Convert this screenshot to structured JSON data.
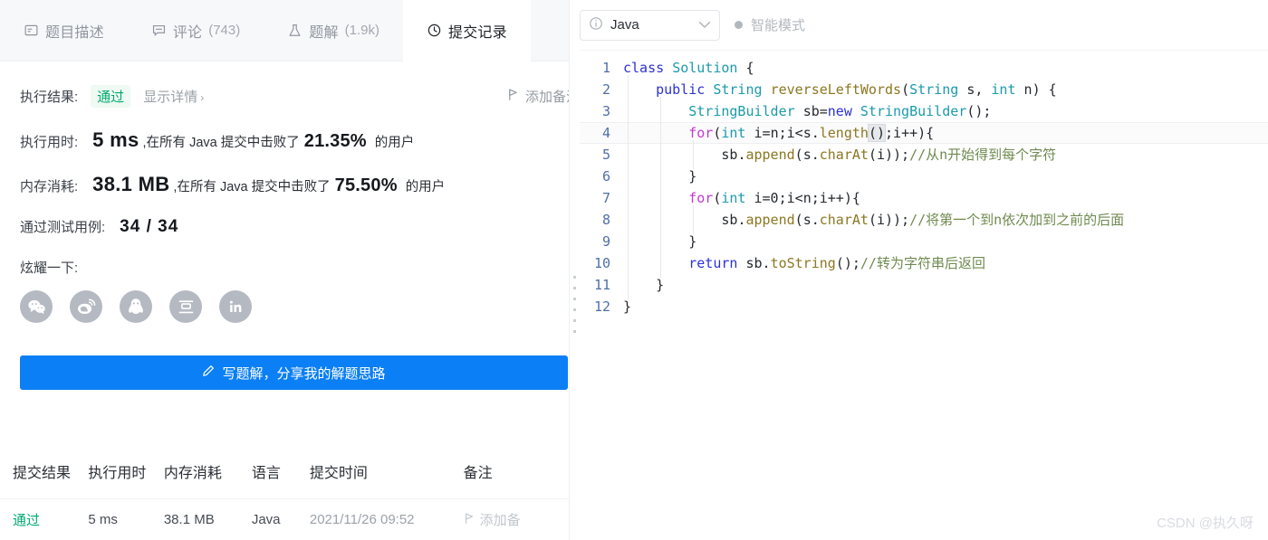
{
  "left": {
    "tabs": [
      {
        "label": "题目描述",
        "count": "",
        "icon": "description-icon",
        "active": false
      },
      {
        "label": "评论",
        "count": "(743)",
        "icon": "comment-icon",
        "active": false
      },
      {
        "label": "题解",
        "count": "(1.9k)",
        "icon": "flask-icon",
        "active": false
      },
      {
        "label": "提交记录",
        "count": "",
        "icon": "clock-icon",
        "active": true
      }
    ],
    "result": {
      "exec_result_label": "执行结果:",
      "status": "通过",
      "status_color": "#00a972",
      "detail_link": "显示详情",
      "detail_chevron": "›",
      "note_button": "添加备注",
      "exec_time_label": "执行用时:",
      "exec_time_value": "5 ms",
      "exec_time_mid": ",在所有 Java 提交中击败了",
      "exec_time_pct": "21.35%",
      "exec_time_suffix": "的用户",
      "memory_label": "内存消耗:",
      "memory_value": "38.1 MB",
      "memory_mid": ",在所有 Java 提交中击败了",
      "memory_pct": "75.50%",
      "memory_suffix": "的用户",
      "cases_label": "通过测试用例:",
      "cases_value": "34 / 34"
    },
    "share": {
      "label": "炫耀一下:",
      "icons": [
        "wechat-icon",
        "weibo-icon",
        "qq-icon",
        "douban-icon",
        "linkedin-icon"
      ]
    },
    "write_button": {
      "label": "写题解，分享我的解题思路",
      "icon": "pencil-icon",
      "color": "#0b7ff5"
    },
    "table": {
      "headers": [
        "提交结果",
        "执行用时",
        "内存消耗",
        "语言",
        "提交时间",
        "备注"
      ],
      "rows": [
        {
          "result": "通过",
          "time": "5 ms",
          "memory": "38.1 MB",
          "language": "Java",
          "submitted": "2021/11/26 09:52",
          "note": "添加备"
        }
      ]
    }
  },
  "right": {
    "language": "Java",
    "language_icon": "info-icon",
    "language_chevron": "⌄",
    "smart_mode": "智能模式",
    "watermark": "CSDN @执久呀",
    "code": {
      "lines": [
        {
          "n": "1",
          "active": false
        },
        {
          "n": "2",
          "active": false
        },
        {
          "n": "3",
          "active": false
        },
        {
          "n": "4",
          "active": true
        },
        {
          "n": "5",
          "active": false
        },
        {
          "n": "6",
          "active": false
        },
        {
          "n": "7",
          "active": false
        },
        {
          "n": "8",
          "active": false
        },
        {
          "n": "9",
          "active": false
        },
        {
          "n": "10",
          "active": false
        },
        {
          "n": "11",
          "active": false
        },
        {
          "n": "12",
          "active": false
        }
      ],
      "text": [
        "class Solution {",
        "    public String reverseLeftWords(String s, int n) {",
        "        StringBuilder sb=new StringBuilder();",
        "        for(int i=n;i<s.length();i++){",
        "            sb.append(s.charAt(i));//从n开始得到每个字符",
        "        }",
        "        for(int i=0;i<n;i++){",
        "            sb.append(s.charAt(i));//将第一个到n依次加到之前的后面",
        "        }",
        "        return sb.toString();//转为字符串后返回",
        "    }",
        "}"
      ]
    }
  }
}
